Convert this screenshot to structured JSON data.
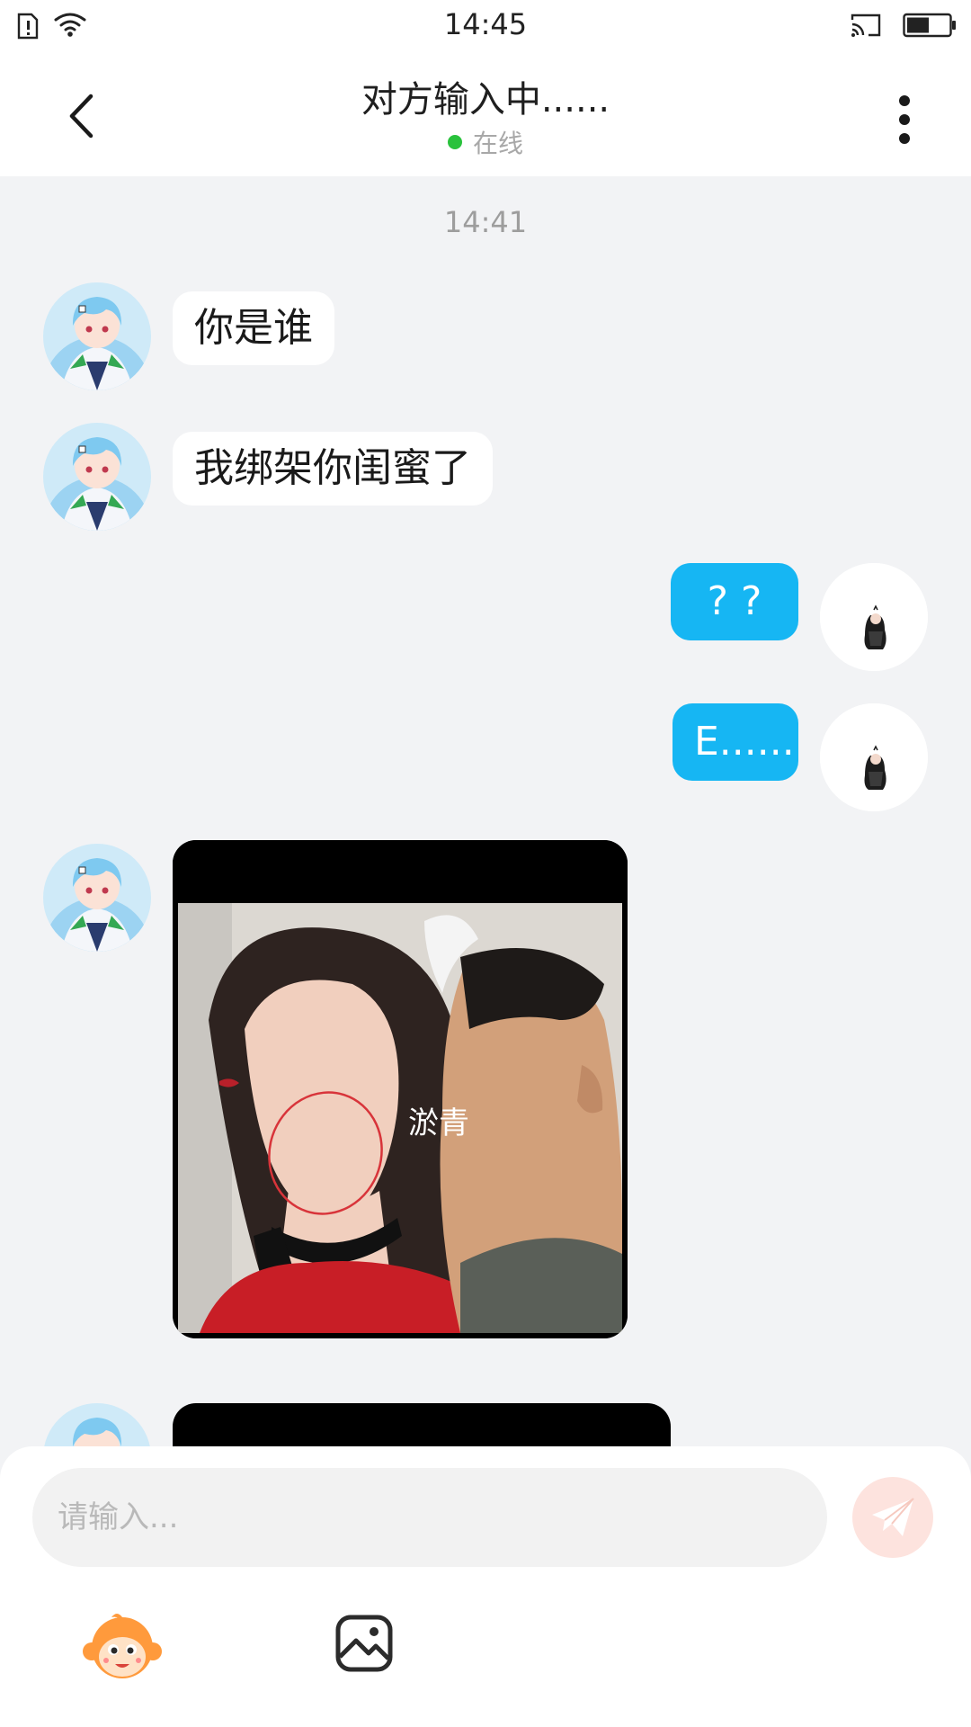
{
  "status_bar": {
    "time": "14:45",
    "icons": [
      "sim-alert-icon",
      "wifi-icon",
      "cast-icon",
      "battery-icon"
    ]
  },
  "header": {
    "title": "对方输入中......",
    "status": "在线",
    "online_color": "#29c23c",
    "back_icon": "chevron-left-icon",
    "more_icon": "more-vertical-icon"
  },
  "chat": {
    "timestamp": "14:41",
    "messages": [
      {
        "side": "left",
        "type": "text",
        "text": "你是谁"
      },
      {
        "side": "left",
        "type": "text",
        "text": "我绑架你闺蜜了"
      },
      {
        "side": "right",
        "type": "text",
        "text": "? ?"
      },
      {
        "side": "right",
        "type": "text",
        "text": "E......"
      },
      {
        "side": "left",
        "type": "image",
        "caption": "淤青"
      },
      {
        "side": "left",
        "type": "image",
        "caption": ""
      }
    ]
  },
  "input_bar": {
    "placeholder": "请输入...",
    "send_icon": "paper-plane-icon",
    "emoji_icon": "monkey-sticker-icon",
    "gallery_icon": "image-gallery-icon"
  },
  "colors": {
    "bubble_right": "#16b6f3",
    "bubble_left": "#ffffff",
    "background": "#f2f3f5",
    "send_button": "#fde3de"
  }
}
